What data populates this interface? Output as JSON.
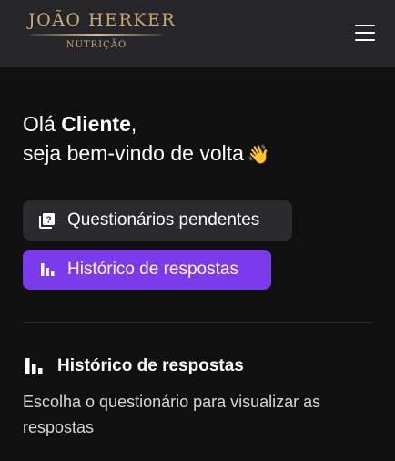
{
  "brand": {
    "name": "JOÃO HERKER",
    "subtitle": "NUTRIÇÃO"
  },
  "header": {
    "menu_icon": "hamburger-menu-icon"
  },
  "greeting": {
    "prefix": "Olá ",
    "name": "Cliente",
    "suffix": ",",
    "line2": "seja bem-vindo de volta",
    "emoji": "👋"
  },
  "nav": {
    "pending": {
      "label": "Questionários pendentes",
      "icon": "quiz-icon"
    },
    "history": {
      "label": "Histórico de respostas",
      "icon": "bar-chart-icon",
      "active": true
    }
  },
  "section": {
    "title": "Histórico de respostas",
    "icon": "bar-chart-icon",
    "description": "Escolha o questionário para visualizar as respostas"
  },
  "colors": {
    "background": "#101011",
    "header": "#26262a",
    "brand_gold": "#c9aa72",
    "accent": "#7c3aed",
    "secondary_button": "#2b2b2f"
  }
}
